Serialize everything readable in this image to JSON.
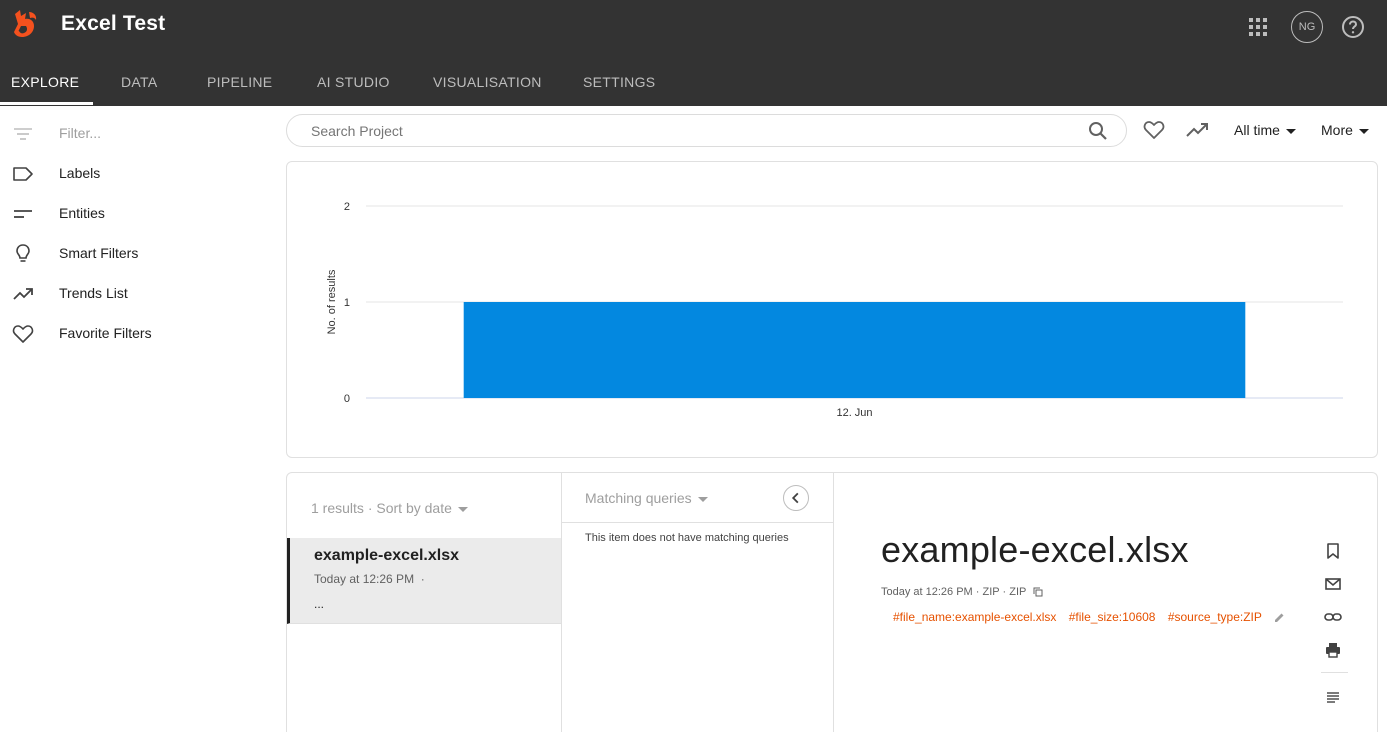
{
  "app": {
    "title": "Excel Test",
    "avatar_initials": "NG"
  },
  "nav": {
    "tabs": [
      "EXPLORE",
      "DATA",
      "PIPELINE",
      "AI STUDIO",
      "VISUALISATION",
      "SETTINGS"
    ],
    "active_tab": "EXPLORE"
  },
  "sidebar": {
    "filter_placeholder": "Filter...",
    "items": [
      {
        "label": "Labels",
        "icon": "label-icon"
      },
      {
        "label": "Entities",
        "icon": "entities-icon"
      },
      {
        "label": "Smart Filters",
        "icon": "lightbulb-icon"
      },
      {
        "label": "Trends List",
        "icon": "trending-up-icon"
      },
      {
        "label": "Favorite Filters",
        "icon": "heart-icon"
      }
    ]
  },
  "search": {
    "placeholder": "Search Project",
    "time_filter": "All time",
    "more_label": "More"
  },
  "chart_data": {
    "type": "bar",
    "categories": [
      "12. Jun"
    ],
    "values": [
      1
    ],
    "ylabel": "No. of results",
    "ylim": [
      0,
      2
    ],
    "yticks": [
      0,
      1,
      2
    ],
    "grid": true,
    "bar_color": "#0388e0"
  },
  "results": {
    "summary": "1 results",
    "sort_label": "Sort by date",
    "items": [
      {
        "title": "example-excel.xlsx",
        "date": "Today at 12:26 PM",
        "snippet": "..."
      }
    ]
  },
  "matching_queries": {
    "header": "Matching queries",
    "empty_text": "This item does not have matching queries"
  },
  "document": {
    "title": "example-excel.xlsx",
    "date": "Today at 12:26 PM",
    "type1": "ZIP",
    "type2": "ZIP",
    "tags": [
      "#file_name:example-excel.xlsx",
      "#file_size:10608",
      "#source_type:ZIP"
    ]
  },
  "colors": {
    "header_bg": "#333333",
    "accent": "#0388e0",
    "tag": "#e65100"
  }
}
